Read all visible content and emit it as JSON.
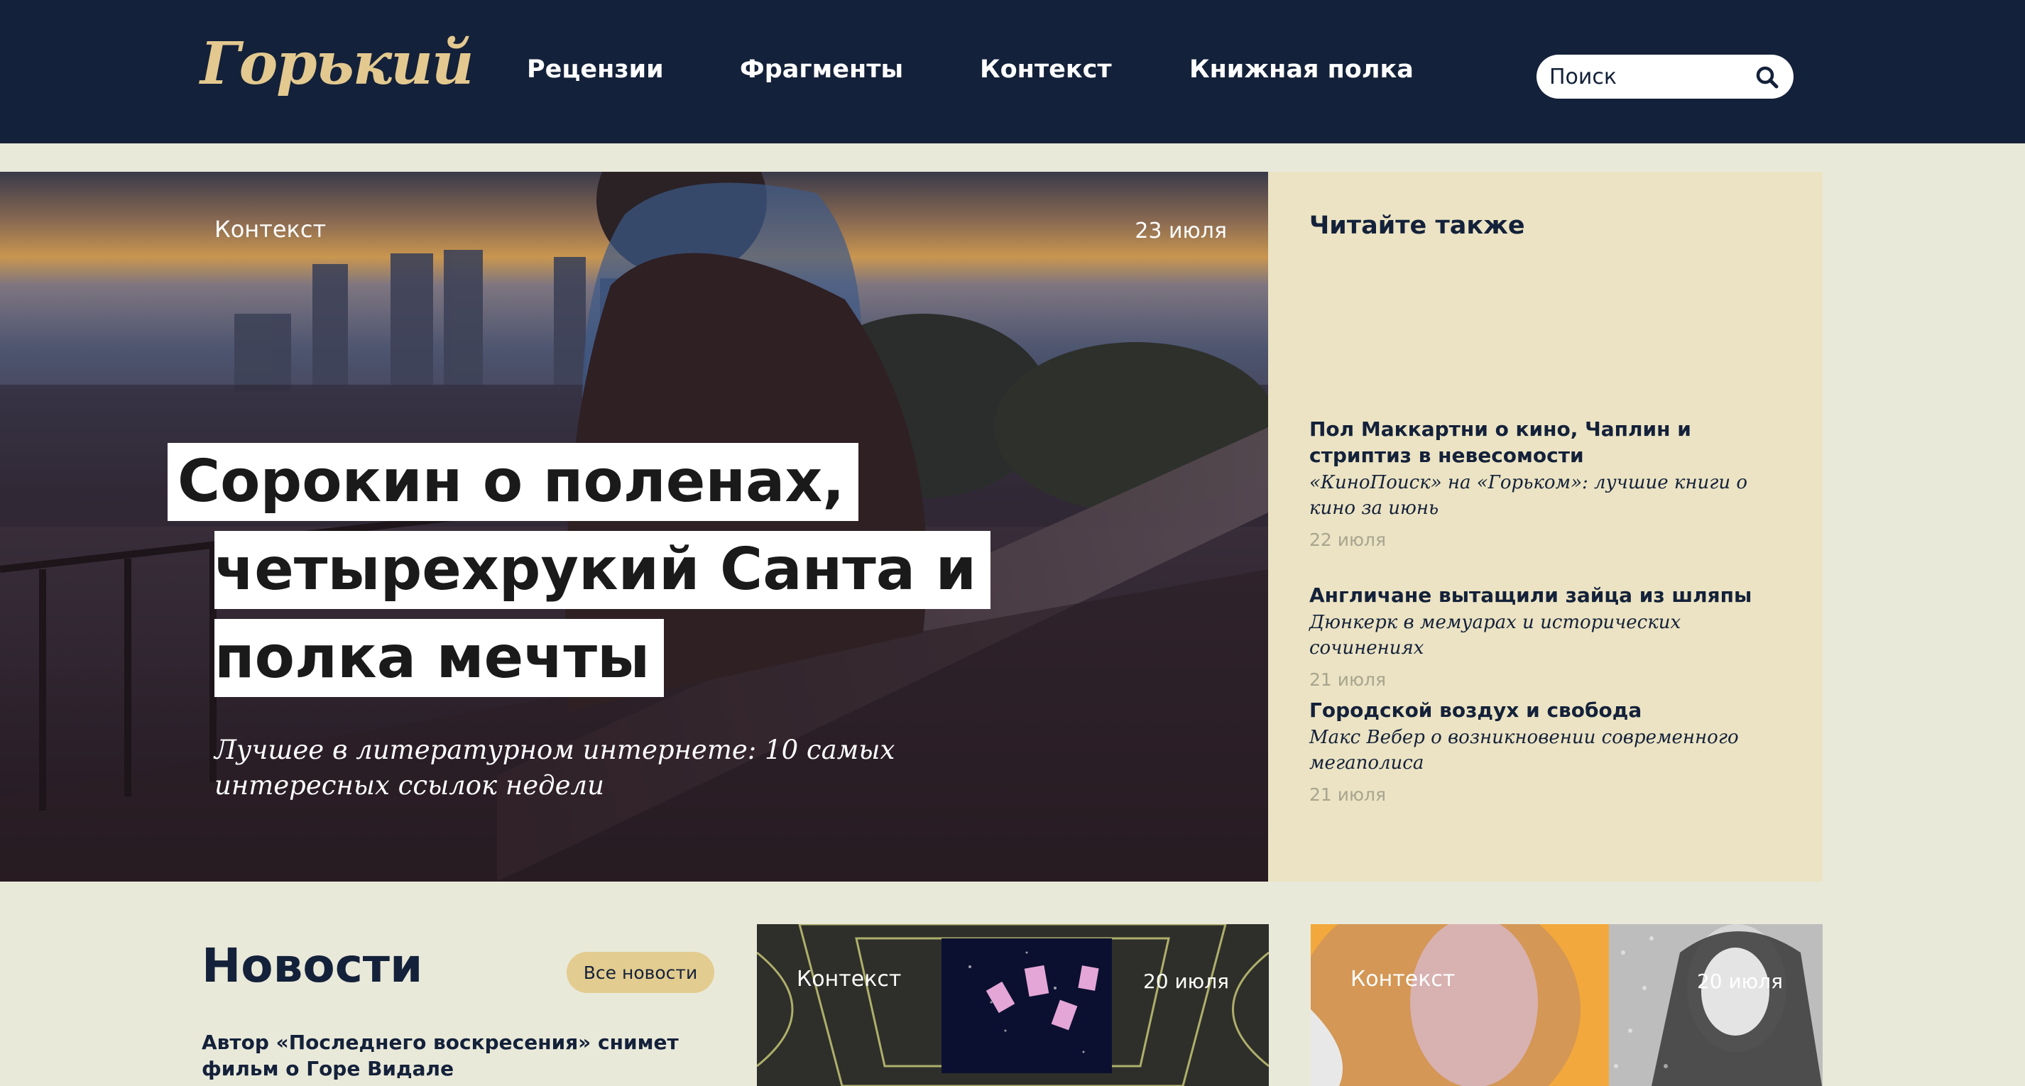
{
  "header": {
    "logo": "Горький",
    "nav": [
      "Рецензии",
      "Фрагменты",
      "Контекст",
      "Книжная полка"
    ],
    "search_placeholder": "Поиск",
    "background_color": "#14213a",
    "logo_color": "#e3c98f"
  },
  "hero": {
    "rubric": "Контекст",
    "date": "23 июля",
    "title_lines": [
      "Сорокин о поленах,",
      "четырехрукий Санта и",
      "полка мечты"
    ],
    "subtitle": "Лучшее в литературном интернете: 10 самых интересных ссылок недели"
  },
  "read_also": {
    "heading": "Читайте также",
    "background_color": "#ebe3c3",
    "items": [
      {
        "title": "Пол Маккартни о кино, Чаплин и стриптиз в невесомости",
        "subtitle": "«КиноПоиск» на «Горьком»: лучшие книги о кино за июнь",
        "date": "22 июля"
      },
      {
        "title": "Англичане вытащили зайца из шляпы",
        "subtitle": "Дюнкерк в мемуарах и исторических сочинениях",
        "date": "21 июля"
      },
      {
        "title": "Городской воздух и свобода",
        "subtitle": "Макс Вебер о возникновении современного мегаполиса",
        "date": "21 июля"
      }
    ]
  },
  "news": {
    "heading": "Новости",
    "all_button": "Все новости",
    "first_item": "Автор «Последнего воскресения» снимет фильм о Горе Видале"
  },
  "cards": [
    {
      "rubric": "Контекст",
      "date": "20 июля"
    },
    {
      "rubric": "Контекст",
      "date": "20 июля"
    }
  ]
}
